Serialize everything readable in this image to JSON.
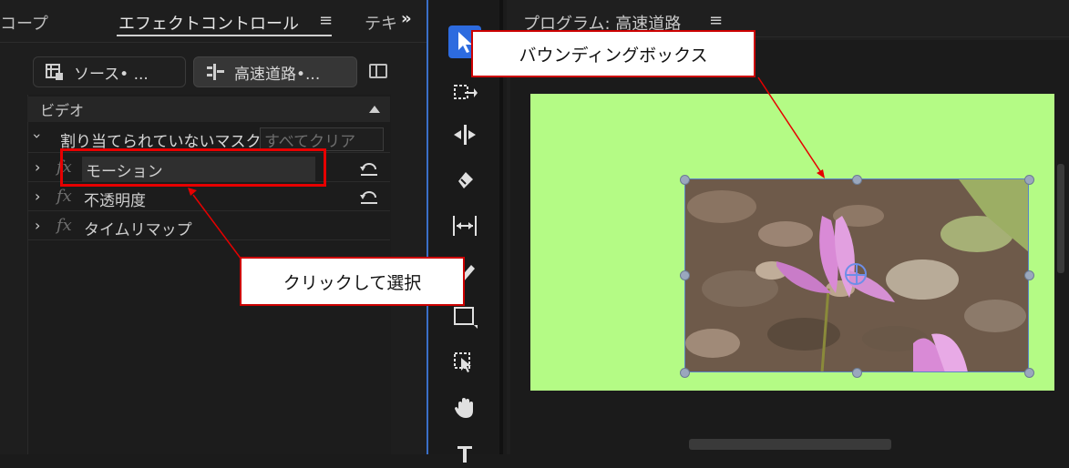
{
  "left_panel": {
    "tabs": [
      "コープ",
      "エフェクトコントロール",
      "テキ"
    ],
    "tab_menu_icon": "≡",
    "more_icon": "»",
    "source_button": "ソース• ...",
    "sequence_button": "高速道路•...",
    "video_header": "ビデオ",
    "rows": {
      "mask": "割り当てられていないマスク",
      "clear_all": "すべてクリア",
      "motion": "モーション",
      "opacity": "不透明度",
      "time_remap": "タイムリマップ"
    },
    "fx_symbol": "fx",
    "chevron_right": "›",
    "chevron_down": "⌄"
  },
  "tools": {
    "icons": [
      "selection-tool-icon",
      "track-select-icon",
      "ripple-edit-icon",
      "razor-icon",
      "slip-icon",
      "pen-icon",
      "rectangle-icon",
      "type-transform-icon",
      "hand-icon",
      "type-icon"
    ],
    "accent": "#2d6bdf"
  },
  "program": {
    "title": "プログラム: 高速道路",
    "menu_icon": "≡",
    "canvas_color": "#b4fb85",
    "bbox_color": "#5b86c6"
  },
  "annotations": {
    "click_to_select": "クリックして選択",
    "bounding_box": "バウンディングボックス",
    "color": "#e60000"
  }
}
